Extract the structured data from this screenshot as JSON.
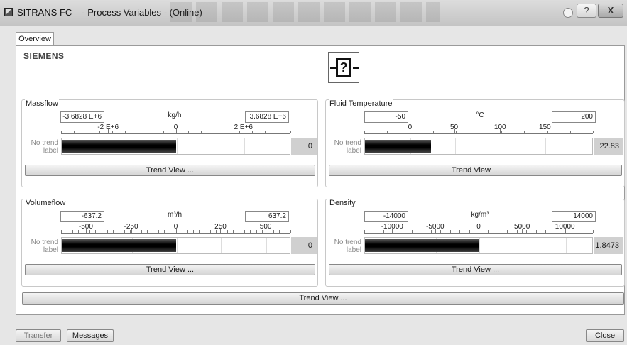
{
  "window": {
    "app": "SITRANS FC",
    "title": "- Process Variables - (Online)"
  },
  "tab": "Overview",
  "brand": "SIEMENS",
  "function_block_icon": "question-mark-function-block-icon",
  "no_trend_label": "No trend label",
  "trend_view_label": "Trend View ...",
  "panels": [
    {
      "title": "Massflow",
      "min": "-3.6828 E+6",
      "max": "3.6828 E+6",
      "unit": "kg/h",
      "ticks": [
        "-2 E+6",
        "0",
        "2 E+6"
      ],
      "value": "0",
      "fill_fraction": 0.5
    },
    {
      "title": "Fluid Temperature",
      "min": "-50",
      "max": "200",
      "unit": "°C",
      "ticks": [
        "0",
        "50",
        "100",
        "150"
      ],
      "value": "22.83",
      "fill_fraction": 0.29
    },
    {
      "title": "Volumeflow",
      "min": "-637.2",
      "max": "637.2",
      "unit": "m³/h",
      "ticks": [
        "-500",
        "-250",
        "0",
        "250",
        "500"
      ],
      "value": "0",
      "fill_fraction": 0.5
    },
    {
      "title": "Density",
      "min": "-14000",
      "max": "14000",
      "unit": "kg/m³",
      "ticks": [
        "-10000",
        "-5000",
        "0",
        "5000",
        "10000"
      ],
      "value": "1.8473",
      "fill_fraction": 0.5
    }
  ],
  "footer": {
    "transfer": "Transfer",
    "messages": "Messages",
    "close": "Close"
  },
  "colors": {
    "bar": "#000000",
    "value_bg": "#d0d0d0",
    "window_bg": "#e6e6e6"
  }
}
